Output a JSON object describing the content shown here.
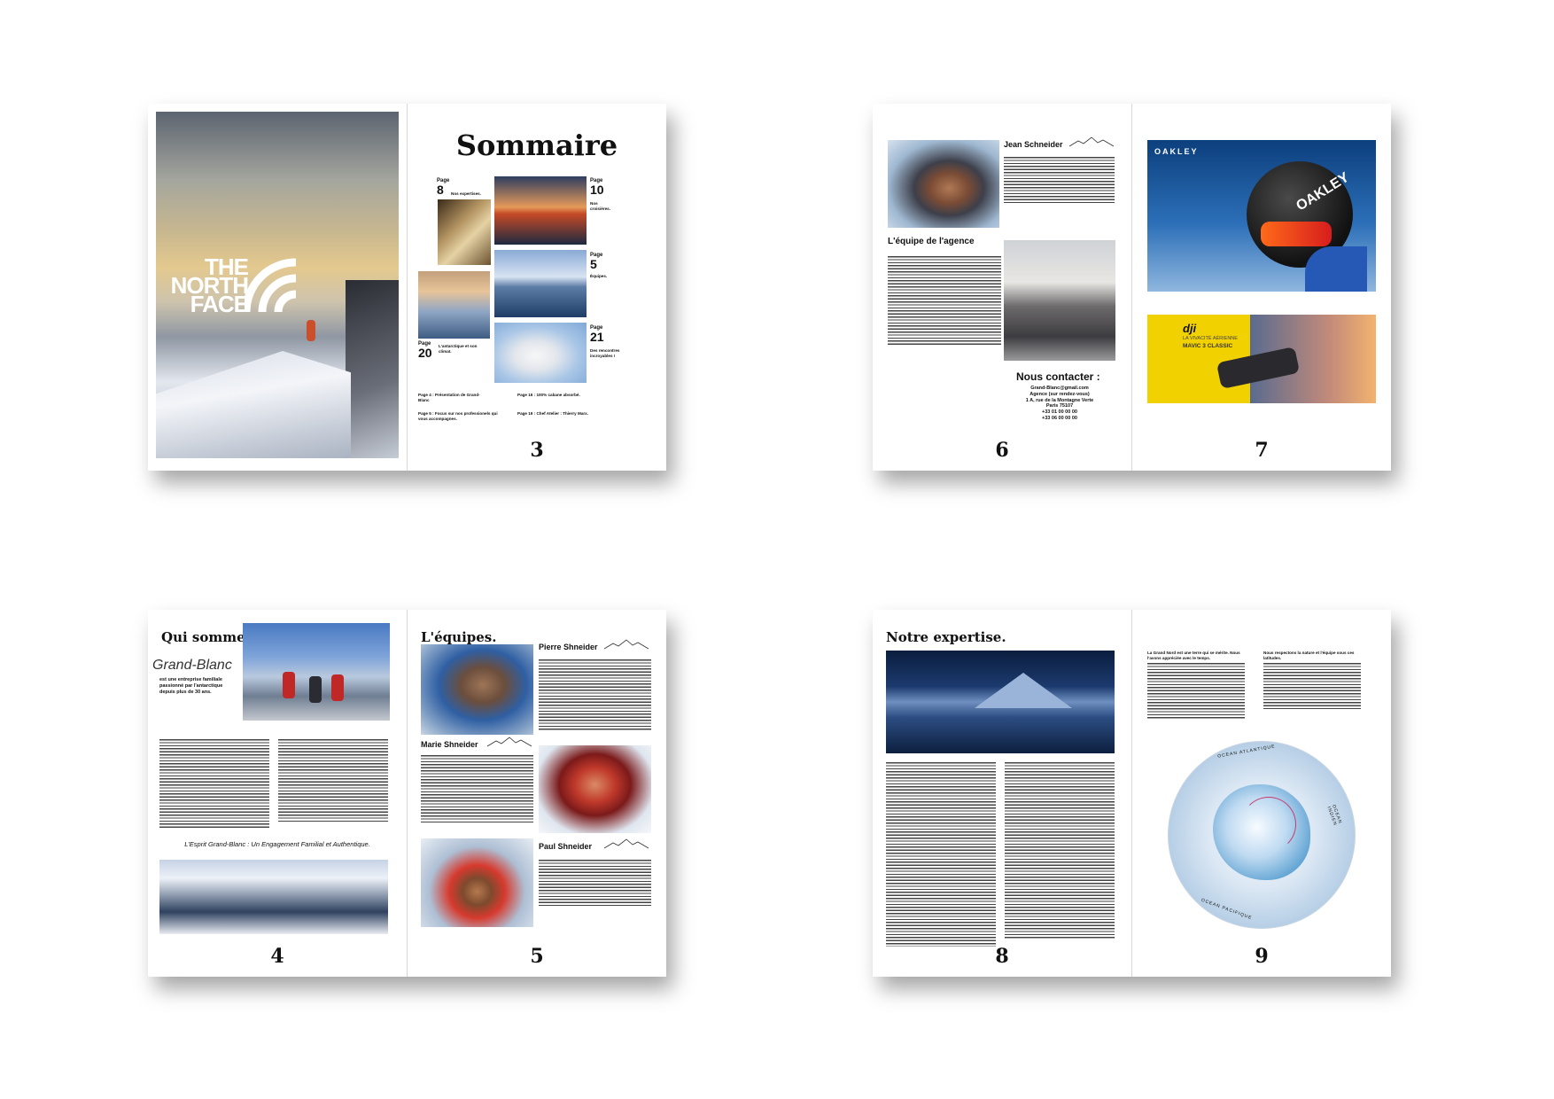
{
  "spread1": {
    "cover": {
      "brand_line1": "THE",
      "brand_line2": "NORTH",
      "brand_line3": "FACE"
    },
    "sommaire": {
      "title": "Sommaire",
      "items": [
        {
          "page_word": "Page",
          "num": "8",
          "caption": "Nos expertises."
        },
        {
          "page_word": "Page",
          "num": "10",
          "caption": "Nos croisières."
        },
        {
          "page_word": "Page",
          "num": "5",
          "caption": "Équipes."
        },
        {
          "page_word": "Page",
          "num": "20",
          "caption": "L'antarctique et son climat."
        },
        {
          "page_word": "Page",
          "num": "21",
          "caption": "Des rencontres incroyables !"
        }
      ],
      "links": [
        "Page 4 : Présentation de Grand-Blanc",
        "Page 5 : Focus sur nos professionels qui vous accompagnes.",
        "Page 16 : 100% cabane absorbé.",
        "Page 19 : Chef Atelier : Thierry Marx."
      ]
    },
    "page_left": "",
    "page_right": "3"
  },
  "spread2": {
    "page6": {
      "person_name": "Jean Schneider",
      "team_heading": "L'équipe de l'agence",
      "contact_heading": "Nous contacter :",
      "contact_lines": [
        "Grand-Blanc@gmail.com",
        "Agence (sur rendez-vous)",
        "1 A, rue de la Montagne Verte",
        "Paris 75107",
        "+33 01 00 00 00",
        "+33 06 00 00 00"
      ],
      "number": "6"
    },
    "page7": {
      "oakley_brand": "OAKLEY",
      "helmet_text": "OAKLEY",
      "dji_brand": "dji",
      "dji_line1": "LA VIVACITÉ AÉRIENNE",
      "dji_line2": "MAVIC 3 CLASSIC",
      "number": "7"
    }
  },
  "spread3": {
    "page4": {
      "title": "Qui somme nous ?",
      "brand": "Grand-Blanc",
      "intro": "est une entreprise familiale passionné par l'antarctique depuis plus de 30 ans.",
      "tagline": "L'Esprit Grand-Blanc : Un Engagement Familial et Authentique.",
      "number": "4"
    },
    "page5": {
      "title": "L'équipes.",
      "names": [
        "Pierre Shneider",
        "Marie Shneider",
        "Paul Shneider"
      ],
      "number": "5"
    }
  },
  "spread4": {
    "page8": {
      "title": "Notre expertise.",
      "number": "8"
    },
    "page9": {
      "intro_left": "La Grand Nord est une terre qui se mérite. Nous l'avons appréciée avec le temps.",
      "intro_right": "Nous respectons la nature et l'équipe sous ces latitudes.",
      "map_label_top": "OCEAN ATLANTIQUE",
      "map_label_bottom": "OCEAN PACIFIQUE",
      "map_label_right": "OCEAN INDIEN",
      "number": "9"
    }
  },
  "colors": {
    "dji_yellow": "#f2d100",
    "shadow": "#000000"
  }
}
